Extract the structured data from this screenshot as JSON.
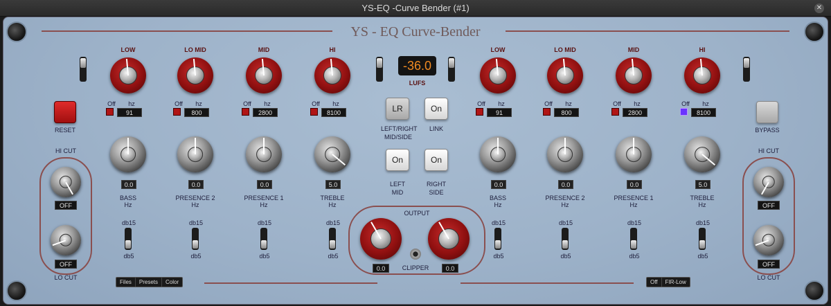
{
  "window": {
    "title": "YS-EQ -Curve Bender (#1)"
  },
  "brand": "YS - EQ Curve-Bender",
  "left": {
    "bands": [
      {
        "label": "LOW",
        "freq": "91"
      },
      {
        "label": "LO MID",
        "freq": "800"
      },
      {
        "label": "MID",
        "freq": "2800"
      },
      {
        "label": "HI",
        "freq": "8100"
      }
    ],
    "gains": [
      {
        "value": "0.0",
        "label1": "BASS",
        "label2": "Hz"
      },
      {
        "value": "0.0",
        "label1": "PRESENCE 2",
        "label2": "Hz"
      },
      {
        "value": "0.0",
        "label1": "PRESENCE 1",
        "label2": "Hz"
      },
      {
        "value": "5.0",
        "label1": "TREBLE",
        "label2": "Hz"
      }
    ],
    "hicut": {
      "label": "HI CUT",
      "value": "OFF"
    },
    "locut": {
      "label": "LO CUT",
      "value": "OFF"
    },
    "reset_label": "RESET"
  },
  "right": {
    "bands": [
      {
        "label": "LOW",
        "freq": "91"
      },
      {
        "label": "LO MID",
        "freq": "800"
      },
      {
        "label": "MID",
        "freq": "2800"
      },
      {
        "label": "HI",
        "freq": "8100"
      }
    ],
    "gains": [
      {
        "value": "0.0",
        "label1": "BASS",
        "label2": "Hz"
      },
      {
        "value": "0.0",
        "label1": "PRESENCE 2",
        "label2": "Hz"
      },
      {
        "value": "0.0",
        "label1": "PRESENCE 1",
        "label2": "Hz"
      },
      {
        "value": "5.0",
        "label1": "TREBLE",
        "label2": "Hz"
      }
    ],
    "hicut": {
      "label": "HI CUT",
      "value": "OFF"
    },
    "locut": {
      "label": "LO CUT",
      "value": "OFF"
    },
    "bypass_label": "BYPASS"
  },
  "common": {
    "off": "Off",
    "hz": "hz",
    "db15": "db15",
    "db5": "db5"
  },
  "center": {
    "lufs_value": "-36.0",
    "lufs_label": "LUFS",
    "lr_button": "LR",
    "link_button": "On",
    "link_label": "LINK",
    "mode_label1": "LEFT/RIGHT",
    "mode_label2": "MID/SIDE",
    "left_button": "On",
    "left_label1": "LEFT",
    "left_label2": "MID",
    "right_button": "On",
    "right_label1": "RIGHT",
    "right_label2": "SIDE",
    "output_label": "OUTPUT",
    "output_left": "0.0",
    "output_right": "0.0",
    "clipper_label": "CLIPPER"
  },
  "footer": {
    "left_buttons": [
      "Files",
      "Presets",
      "Color"
    ],
    "right_buttons": [
      "Off",
      "FIR-Low"
    ]
  },
  "colors": {
    "panel": "#9db2c9",
    "accent": "#8a1a1a",
    "lufs": "#f08a22",
    "active_led": "#6a33ff"
  }
}
